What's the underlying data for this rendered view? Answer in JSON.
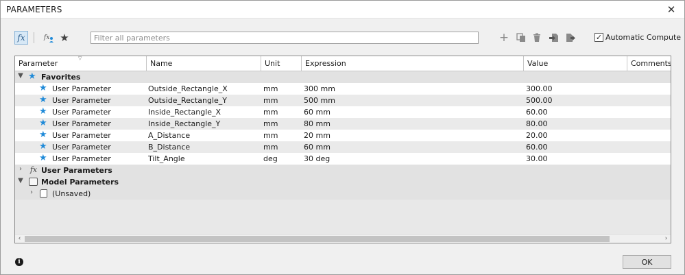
{
  "window": {
    "title": "PARAMETERS",
    "close_symbol": "✕"
  },
  "toolbar": {
    "fx_label": "fx",
    "filter_placeholder": "Filter all parameters",
    "auto_compute_label": "Automatic Compute",
    "auto_compute_checked": true
  },
  "table": {
    "columns": [
      "Parameter",
      "Name",
      "Unit",
      "Expression",
      "Value",
      "Comments"
    ],
    "groups": {
      "favorites": "Favorites",
      "user": "User Parameters",
      "model": "Model Parameters",
      "unsaved": "(Unsaved)"
    },
    "rows": [
      {
        "type": "User Parameter",
        "name": "Outside_Rectangle_X",
        "unit": "mm",
        "expression": "300 mm",
        "value": "300.00"
      },
      {
        "type": "User Parameter",
        "name": "Outside_Rectangle_Y",
        "unit": "mm",
        "expression": "500 mm",
        "value": "500.00"
      },
      {
        "type": "User Parameter",
        "name": "Inside_Rectangle_X",
        "unit": "mm",
        "expression": "60 mm",
        "value": "60.00"
      },
      {
        "type": "User Parameter",
        "name": "Inside_Rectangle_Y",
        "unit": "mm",
        "expression": "80 mm",
        "value": "80.00"
      },
      {
        "type": "User Parameter",
        "name": "A_Distance",
        "unit": "mm",
        "expression": "20 mm",
        "value": "20.00"
      },
      {
        "type": "User Parameter",
        "name": "B_Distance",
        "unit": "mm",
        "expression": "60 mm",
        "value": "60.00"
      },
      {
        "type": "User Parameter",
        "name": "Tilt_Angle",
        "unit": "deg",
        "expression": "30 deg",
        "value": "30.00"
      }
    ]
  },
  "footer": {
    "ok_label": "OK",
    "info_symbol": "i"
  },
  "colors": {
    "accent_star": "#1f8ad8",
    "selected_fx": "#d7e8f6"
  }
}
